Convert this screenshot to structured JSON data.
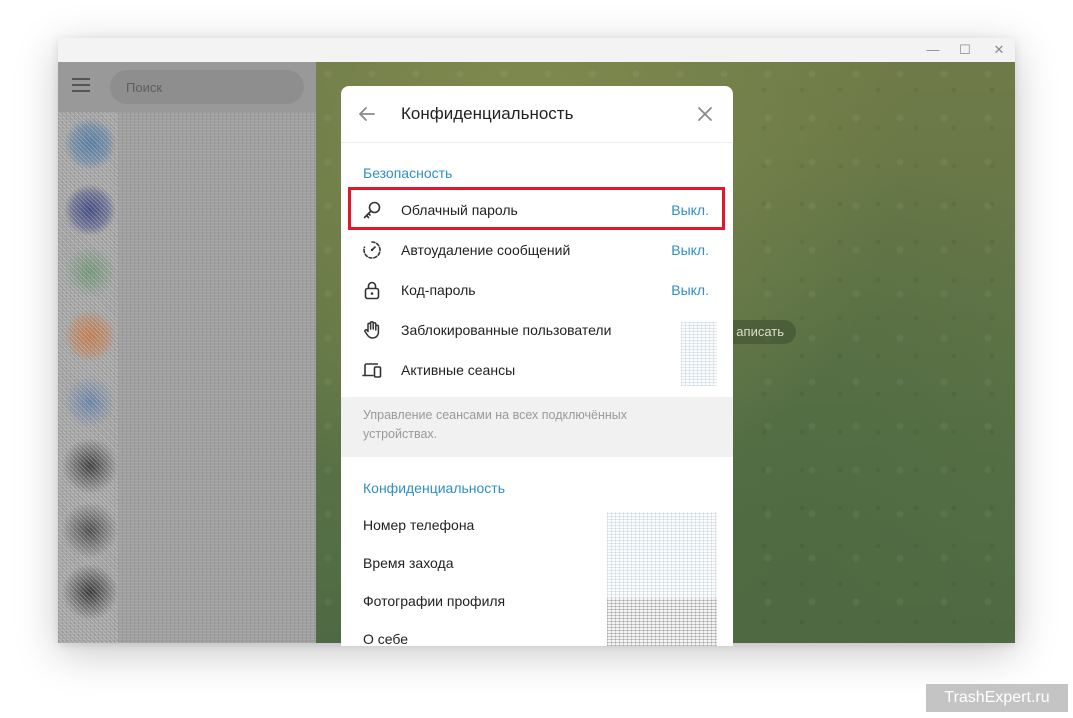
{
  "window_controls": {
    "minimize": "—",
    "maximize": "☐",
    "close": "✕"
  },
  "sidebar": {
    "search": {
      "placeholder": "Поиск",
      "value": ""
    }
  },
  "chat": {
    "write_label": "аписать"
  },
  "dialog": {
    "title": "Конфиденциальность",
    "security": {
      "title": "Безопасность",
      "items": [
        {
          "label": "Облачный пароль",
          "value": "Выкл.",
          "icon": "key-icon"
        },
        {
          "label": "Автоудаление сообщений",
          "value": "Выкл.",
          "icon": "timer-icon"
        },
        {
          "label": "Код-пароль",
          "value": "Выкл.",
          "icon": "lock-icon"
        },
        {
          "label": "Заблокированные пользователи",
          "value": "",
          "icon": "hand-icon"
        },
        {
          "label": "Активные сеансы",
          "value": "",
          "icon": "devices-icon"
        }
      ],
      "hint": "Управление сеансами на всех подключённых устройствах."
    },
    "privacy": {
      "title": "Конфиденциальность",
      "items": [
        {
          "label": "Номер телефона"
        },
        {
          "label": "Время захода"
        },
        {
          "label": "Фотографии профиля"
        },
        {
          "label": "О себе"
        }
      ]
    }
  },
  "colors": {
    "accent": "#2f8fc4",
    "highlight": "#e0182c"
  },
  "watermark": "TrashExpert.ru"
}
